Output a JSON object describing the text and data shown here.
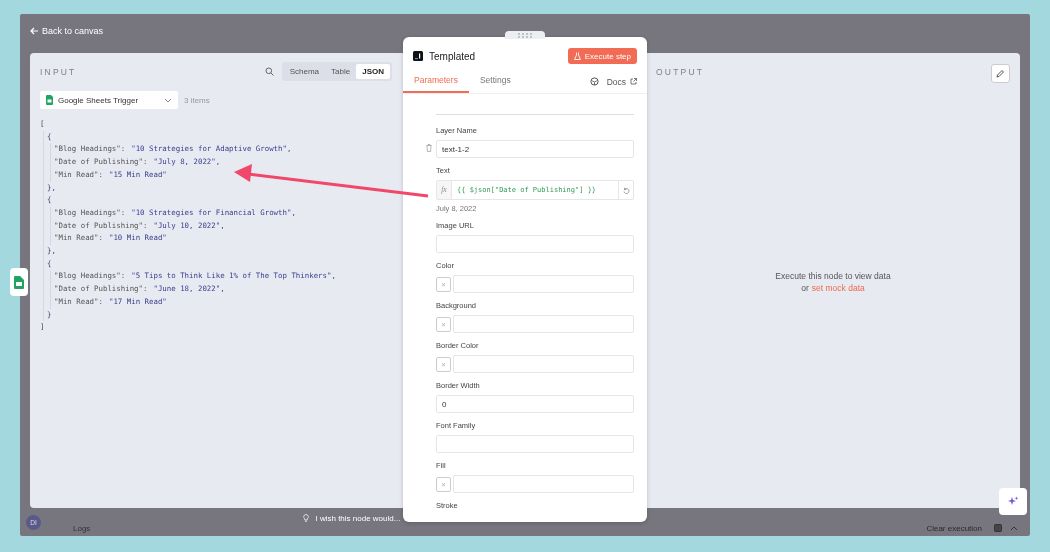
{
  "top_bar": {
    "back_label": "Back to canvas"
  },
  "input_panel": {
    "title": "INPUT",
    "view_tabs": [
      {
        "label": "Schema",
        "selected": false
      },
      {
        "label": "Table",
        "selected": false
      },
      {
        "label": "JSON",
        "selected": true
      }
    ],
    "source": {
      "label": "Google Sheets Trigger",
      "count": "3 items"
    },
    "json_view": {
      "open": "[",
      "close": "]",
      "items": [
        {
          "open": "{",
          "close": "},",
          "pairs": [
            {
              "key": "\"Blog Headings\":",
              "value": "\"10 Strategies for Adaptive Growth\","
            },
            {
              "key": "\"Date of Publishing\":",
              "value": "\"July 8, 2022\","
            },
            {
              "key": "\"Min Read\":",
              "value": "\"15 Min Read\""
            }
          ]
        },
        {
          "open": "{",
          "close": "},",
          "pairs": [
            {
              "key": "\"Blog Headings\":",
              "value": "\"10 Strategies for Financial Growth\","
            },
            {
              "key": "\"Date of Publishing\":",
              "value": "\"July 10, 2022\","
            },
            {
              "key": "\"Min Read\":",
              "value": "\"10 Min Read\""
            }
          ]
        },
        {
          "open": "{",
          "close": "}",
          "pairs": [
            {
              "key": "\"Blog Headings\":",
              "value": "\"5 Tips to Think Like 1% of The Top Thinkers\","
            },
            {
              "key": "\"Date of Publishing\":",
              "value": "\"June 18, 2022\","
            },
            {
              "key": "\"Min Read\":",
              "value": "\"17 Min Read\""
            }
          ]
        }
      ]
    }
  },
  "node_panel": {
    "title": "Templated",
    "execute_label": "Execute step",
    "tabs": [
      {
        "label": "Parameters",
        "selected": true
      },
      {
        "label": "Settings",
        "selected": false
      }
    ],
    "docs_label": "Docs",
    "fields": [
      {
        "kind": "text",
        "label": "Layer Name",
        "value": "text-1-2",
        "deletable": true
      },
      {
        "kind": "expression",
        "label": "Text",
        "prefix": "fx",
        "value": "{{ $json[\"Date of Publishing\"] }}",
        "result": "July 8, 2022"
      },
      {
        "kind": "text",
        "label": "Image URL"
      },
      {
        "kind": "color",
        "label": "Color",
        "swatch": "×"
      },
      {
        "kind": "color",
        "label": "Background",
        "swatch": "×"
      },
      {
        "kind": "color",
        "label": "Border Color",
        "swatch": "×"
      },
      {
        "kind": "text",
        "label": "Border Width",
        "value": "0"
      },
      {
        "kind": "text",
        "label": "Font Family"
      },
      {
        "kind": "color",
        "label": "Fill",
        "swatch": "×"
      },
      {
        "kind": "heading",
        "label": "Stroke"
      }
    ]
  },
  "output_panel": {
    "title": "OUTPUT",
    "message": "Execute this node to view data",
    "or_text": "or",
    "mock_link": "set mock data"
  },
  "bottom_bar": {
    "avatar": "DI",
    "logs_label": "Logs",
    "feedback": "I wish this node would...",
    "clear_label": "Clear execution"
  }
}
